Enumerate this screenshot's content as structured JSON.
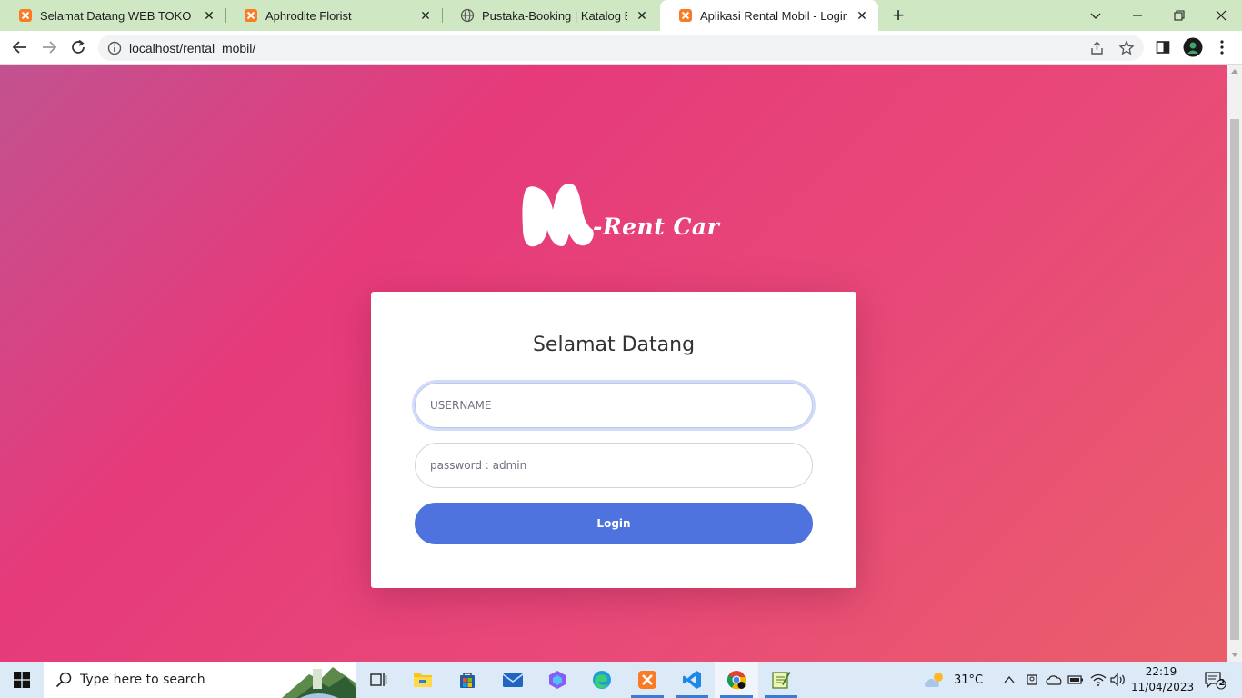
{
  "browser": {
    "tabs": [
      {
        "title": "Selamat Datang WEB TOKO BUN",
        "icon": "xampp-icon",
        "active": false
      },
      {
        "title": "Aphrodite Florist",
        "icon": "xampp-icon",
        "active": false
      },
      {
        "title": "Pustaka-Booking | Katalog Buku",
        "icon": "globe-icon",
        "active": false
      },
      {
        "title": "Aplikasi Rental Mobil - Login",
        "icon": "xampp-icon",
        "active": true
      }
    ],
    "url": "localhost/rental_mobil/"
  },
  "page": {
    "logo_text": "-Rent Car",
    "heading": "Selamat Datang",
    "username_placeholder": "USERNAME",
    "password_placeholder": "password : admin",
    "login_label": "Login",
    "colors": {
      "gradient_start": "#c25290",
      "gradient_mid": "#e63a7a",
      "gradient_end": "#ea5f6a",
      "button": "#4e73df"
    }
  },
  "taskbar": {
    "search_placeholder": "Type here to search",
    "apps": [
      "task-view-icon",
      "file-explorer-icon",
      "store-icon",
      "mail-icon",
      "copilot-icon",
      "edge-icon",
      "xampp-icon",
      "vscode-icon",
      "chrome-icon",
      "notepad-icon"
    ],
    "weather": "31°C",
    "time": "22:19",
    "date": "11/04/2023",
    "notification_count": "2"
  }
}
